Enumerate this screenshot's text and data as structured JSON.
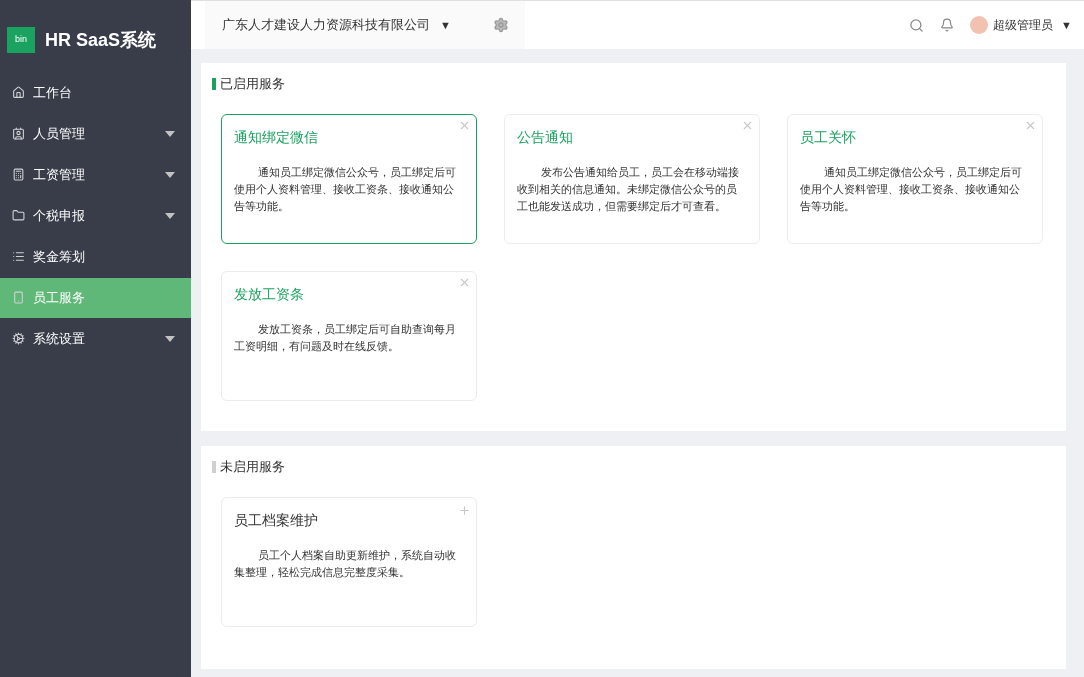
{
  "logo": {
    "badge": "bin",
    "title": "HR SaaS系统"
  },
  "sidebar": {
    "items": [
      {
        "label": "工作台",
        "expandable": false,
        "selected": false
      },
      {
        "label": "人员管理",
        "expandable": true,
        "selected": false
      },
      {
        "label": "工资管理",
        "expandable": true,
        "selected": false
      },
      {
        "label": "个税申报",
        "expandable": true,
        "selected": false
      },
      {
        "label": "奖金筹划",
        "expandable": false,
        "selected": false
      },
      {
        "label": "员工服务",
        "expandable": false,
        "selected": true
      },
      {
        "label": "系统设置",
        "expandable": true,
        "selected": false
      }
    ]
  },
  "header": {
    "company": "广东人才建设人力资源科技有限公司",
    "dropdown": "▼",
    "user": "超级管理员",
    "user_dropdown": "▼"
  },
  "sections": [
    {
      "title": "已启用服务",
      "enabled": true,
      "cards": [
        {
          "title": "通知绑定微信",
          "description": "通知员工绑定微信公众号，员工绑定后可使用个人资料管理、接收工资条、接收通知公告等功能。",
          "selected": true
        },
        {
          "title": "公告通知",
          "description": "发布公告通知给员工，员工会在移动端接收到相关的信息通知。未绑定微信公众号的员工也能发送成功，但需要绑定后才可查看。",
          "selected": false
        },
        {
          "title": "员工关怀",
          "description": "通知员工绑定微信公众号，员工绑定后可使用个人资料管理、接收工资条、接收通知公告等功能。",
          "selected": false
        },
        {
          "title": "发放工资条",
          "description": "发放工资条，员工绑定后可自助查询每月工资明细，有问题及时在线反馈。",
          "selected": false
        }
      ]
    },
    {
      "title": "未启用服务",
      "enabled": false,
      "cards": [
        {
          "title": "员工档案维护",
          "description": "员工个人档案自助更新维护，系统自动收集整理，轻松完成信息完整度采集。",
          "selected": false
        }
      ]
    }
  ]
}
